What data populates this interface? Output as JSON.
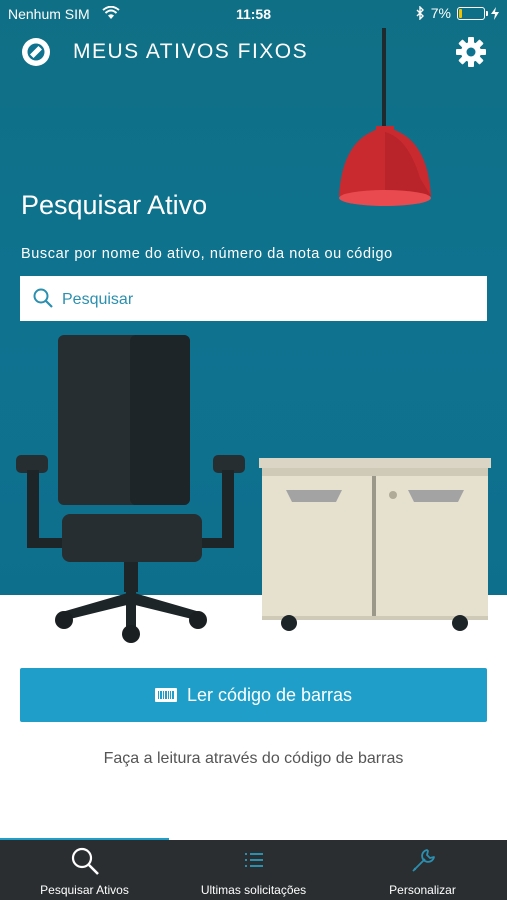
{
  "status_bar": {
    "carrier": "Nenhum SIM",
    "time": "11:58",
    "battery": "7%"
  },
  "app_bar": {
    "title": "MEUS ATIVOS FIXOS"
  },
  "search_section": {
    "title": "Pesquisar Ativo",
    "subtitle": "Buscar por nome do ativo, número da nota ou código",
    "placeholder": "Pesquisar"
  },
  "barcode": {
    "button_label": "Ler código de barras",
    "hint": "Faça a leitura através do código de barras"
  },
  "tabs": [
    {
      "label": "Pesquisar Ativos",
      "icon": "search-icon",
      "active": true
    },
    {
      "label": "Ultimas solicitações",
      "icon": "list-icon",
      "active": false
    },
    {
      "label": "Personalizar",
      "icon": "wrench-icon",
      "active": false
    }
  ],
  "colors": {
    "hero": "#0f7390",
    "accent": "#1e9ec9",
    "lamp": "#e2363b",
    "tabbar": "#2a2e31"
  }
}
